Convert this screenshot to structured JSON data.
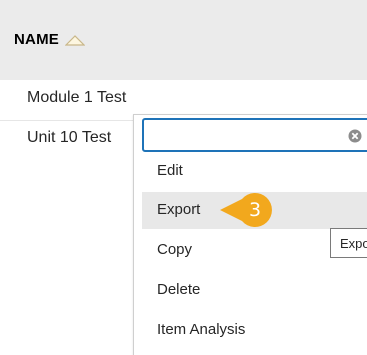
{
  "table": {
    "column_header": "NAME",
    "sort_icon": "sort-ascending-triangle-icon",
    "rows": [
      {
        "name": "Module 1 Test"
      },
      {
        "name": "Unit 10 Test"
      }
    ]
  },
  "context_menu": {
    "search_value": "",
    "clear_icon": "clear-circle-x-icon",
    "items": [
      {
        "label": "Edit"
      },
      {
        "label": "Export"
      },
      {
        "label": "Copy"
      },
      {
        "label": "Delete"
      },
      {
        "label": "Item Analysis"
      }
    ],
    "tooltip_text": "Export"
  },
  "callout": {
    "step_number": "3",
    "color": "#f2a81d"
  },
  "colors": {
    "header_bg": "#ebebeb",
    "search_border": "#1e73b8",
    "highlight_bg": "#e8e8e8"
  }
}
